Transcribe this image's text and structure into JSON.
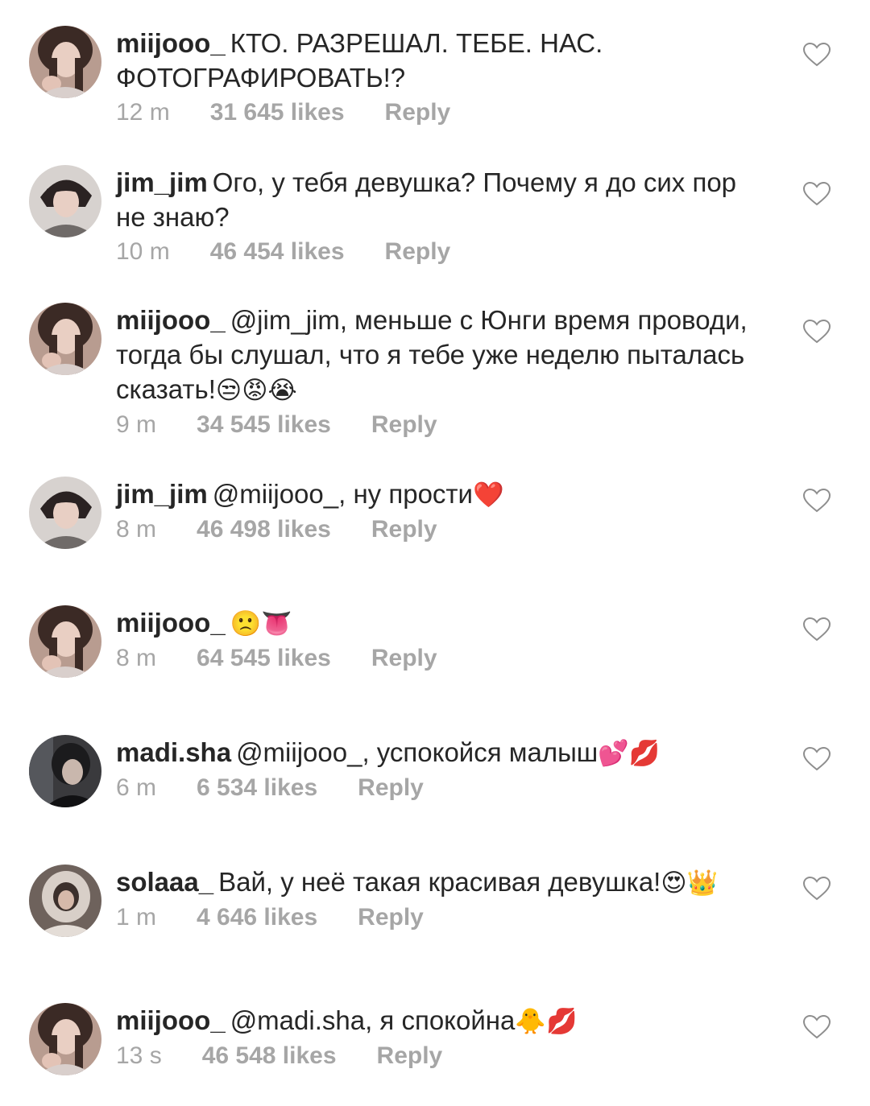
{
  "comments": [
    {
      "username": "miijooo_",
      "text": "КТО. РАЗРЕШАЛ. ТЕБЕ. НАС. ФОТОГРАФИРОВАТЬ!?",
      "emojis": "",
      "time": "12 m",
      "likes": "31 645 likes",
      "reply": "Reply",
      "avatar": "girl-avatar-icon"
    },
    {
      "username": "jim_jim",
      "text": "Ого, у тебя девушка? Почему я до сих пор не знаю?",
      "emojis": "",
      "time": "10 m",
      "likes": "46 454 likes",
      "reply": "Reply",
      "avatar": "boy-avatar-icon"
    },
    {
      "username": "miijooo_",
      "text": "@jim_jim, меньше с Юнги время проводи, тогда бы слушал, что я тебе уже неделю пыталась сказать!",
      "emojis": "😒😡😭",
      "time": "9 m",
      "likes": "34 545 likes",
      "reply": "Reply",
      "avatar": "girl-avatar-icon"
    },
    {
      "username": "jim_jim",
      "text": "@miijooo_, ну прости",
      "emojis": "❤️",
      "time": "8 m",
      "likes": "46 498 likes",
      "reply": "Reply",
      "avatar": "boy-avatar-icon"
    },
    {
      "username": "miijooo_",
      "text": "",
      "emojis": "🙁👅",
      "time": "8 m",
      "likes": "64 545 likes",
      "reply": "Reply",
      "avatar": "girl-avatar-icon"
    },
    {
      "username": "madi.sha",
      "text": "@miijooo_, успокойся малыш",
      "emojis": "💕💋",
      "time": "6 m",
      "likes": "6 534 likes",
      "reply": "Reply",
      "avatar": "dark-avatar-icon"
    },
    {
      "username": "solaaa_",
      "text": "Вай, у неё такая красивая девушка!",
      "emojis": "😍👑",
      "time": "1 m",
      "likes": "4 646 likes",
      "reply": "Reply",
      "avatar": "hoodie-avatar-icon"
    },
    {
      "username": "miijooo_",
      "text": "@madi.sha, я спокойна",
      "emojis": "🐥💋",
      "time": "13 s",
      "likes": "46 548 likes",
      "reply": "Reply",
      "avatar": "girl-avatar-icon"
    }
  ],
  "icons": {
    "like": "heart-outline-icon"
  },
  "colors": {
    "text": "#262626",
    "meta": "#a6a6a6",
    "heart": "#8e8e8e",
    "background": "#ffffff"
  }
}
